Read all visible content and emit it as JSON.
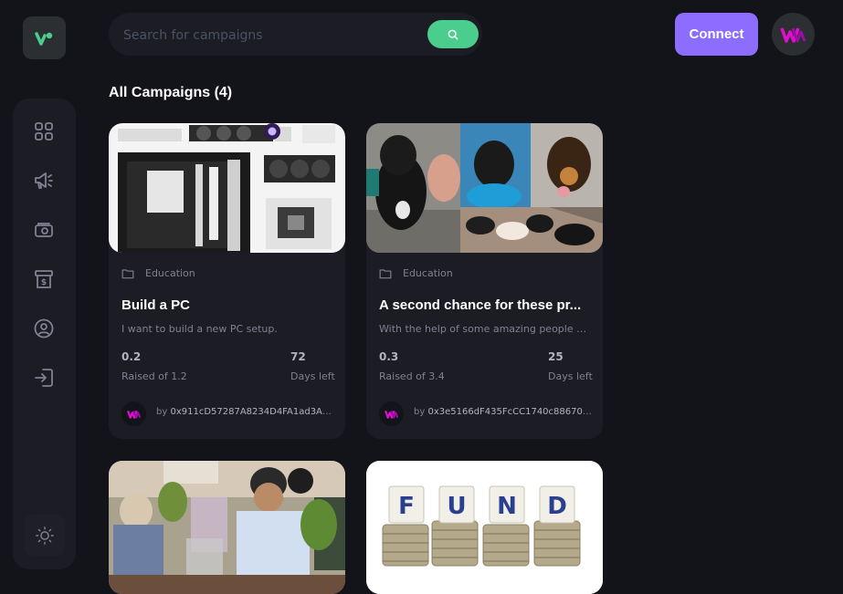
{
  "search": {
    "placeholder": "Search for campaigns"
  },
  "header": {
    "connect_label": "Connect"
  },
  "heading": "All Campaigns (4)",
  "cards": [
    {
      "category": "Education",
      "title": "Build a PC",
      "description": "I want to build a new PC setup.",
      "raised": "0.2",
      "raised_label": "Raised of 1.2",
      "days": "72",
      "days_label": "Days left",
      "owner_prefix": "by",
      "owner": "0x911cD57287A8234D4FA1ad3A12..."
    },
    {
      "category": "Education",
      "title": "A second chance for these pr...",
      "description": "With the help of some amazing people we...",
      "raised": "0.3",
      "raised_label": "Raised of 3.4",
      "days": "25",
      "days_label": "Days left",
      "owner_prefix": "by",
      "owner": "0x3e5166dF435FcCC1740c886709..."
    }
  ],
  "fund_letters": [
    "F",
    "U",
    "N",
    "D"
  ],
  "colors": {
    "background": "#13131a",
    "panel": "#1c1c24",
    "accent_green": "#4acd8d",
    "accent_purple": "#8c6dfd",
    "muted_text": "#808191",
    "logo_mark": "#e00fcf"
  },
  "icons": {
    "logo": "v-logo-icon",
    "sidebar": [
      "dashboard-icon",
      "campaign-icon",
      "payment-icon",
      "withdraw-icon",
      "profile-icon",
      "logout-icon"
    ],
    "theme": "sun-icon",
    "search": "search-icon",
    "category": "folder-icon",
    "avatar": "w-logo-icon"
  }
}
